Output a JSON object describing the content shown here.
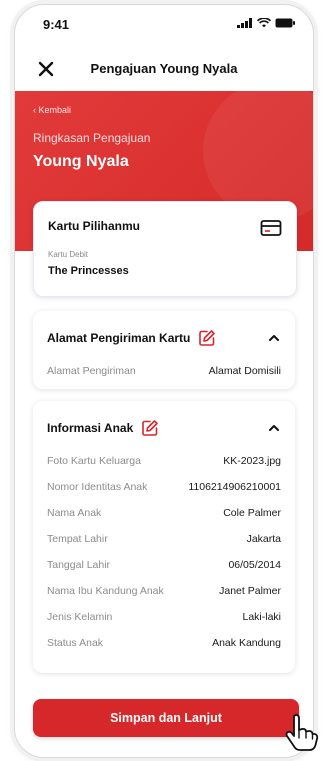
{
  "status": {
    "time": "9:41"
  },
  "topbar": {
    "title": "Pengajuan Young Nyala"
  },
  "header": {
    "back": "‹ Kembali",
    "label": "Ringkasan Pengajuan",
    "product": "Young Nyala"
  },
  "kartu": {
    "title": "Kartu Pilihanmu",
    "type_label": "Kartu Debit",
    "name": "The Princesses"
  },
  "alamat": {
    "title": "Alamat Pengiriman Kartu",
    "rows": [
      {
        "label": "Alamat Pengiriman",
        "value": "Alamat Domisili"
      }
    ]
  },
  "anak": {
    "title": "Informasi Anak",
    "rows": [
      {
        "label": "Foto Kartu Keluarga",
        "value": "KK-2023.jpg"
      },
      {
        "label": "Nomor Identitas Anak",
        "value": "1106214906210001"
      },
      {
        "label": "Nama Anak",
        "value": "Cole Palmer"
      },
      {
        "label": "Tempat Lahir",
        "value": "Jakarta"
      },
      {
        "label": "Tanggal Lahir",
        "value": "06/05/2014"
      },
      {
        "label": "Nama Ibu Kandung Anak",
        "value": "Janet Palmer"
      },
      {
        "label": "Jenis Kelamin",
        "value": "Laki-laki"
      },
      {
        "label": "Status Anak",
        "value": "Anak Kandung"
      }
    ]
  },
  "cta": {
    "label": "Simpan dan Lanjut"
  },
  "colors": {
    "brand_red": "#d6272b"
  },
  "icons": [
    "signal-icon",
    "wifi-icon",
    "battery-icon",
    "close-icon",
    "card-icon",
    "edit-icon",
    "chevron-up-icon",
    "hand-pointer-icon"
  ]
}
